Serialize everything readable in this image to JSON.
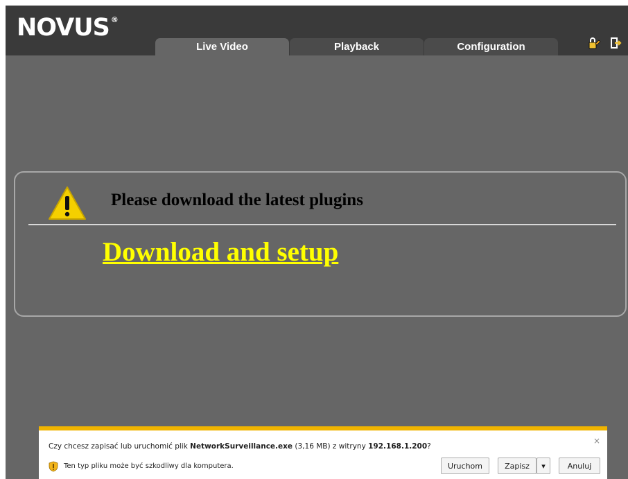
{
  "header": {
    "logo_text": "NOVUS",
    "logo_mark": "®",
    "tabs": [
      {
        "label": "Live Video",
        "active": true
      },
      {
        "label": "Playback",
        "active": false
      },
      {
        "label": "Configuration",
        "active": false
      }
    ],
    "icons": [
      "lock-user-icon",
      "logout-icon"
    ]
  },
  "plugin_notice": {
    "message": "Please download the latest plugins",
    "link_label": "Download and setup",
    "icon": "warning-icon"
  },
  "download_bar": {
    "question_prefix": "Czy chcesz zapisać lub uruchomić plik ",
    "file_name": "NetworkSurveillance.exe",
    "question_size": " (3,16 MB) z witryny ",
    "site": "192.168.1.200",
    "question_suffix": "?",
    "warning": "Ten typ pliku może być szkodliwy dla komputera.",
    "close_glyph": "×",
    "buttons": {
      "run": "Uruchom",
      "save": "Zapisz",
      "save_arrow": "▾",
      "cancel": "Anuluj"
    }
  },
  "colors": {
    "page_bg": "#666666",
    "header_bg": "#3a3a3a",
    "inactive_tab": "#4b4b4b",
    "link": "#ffff00",
    "download_bar_accent": "#f0b400"
  }
}
